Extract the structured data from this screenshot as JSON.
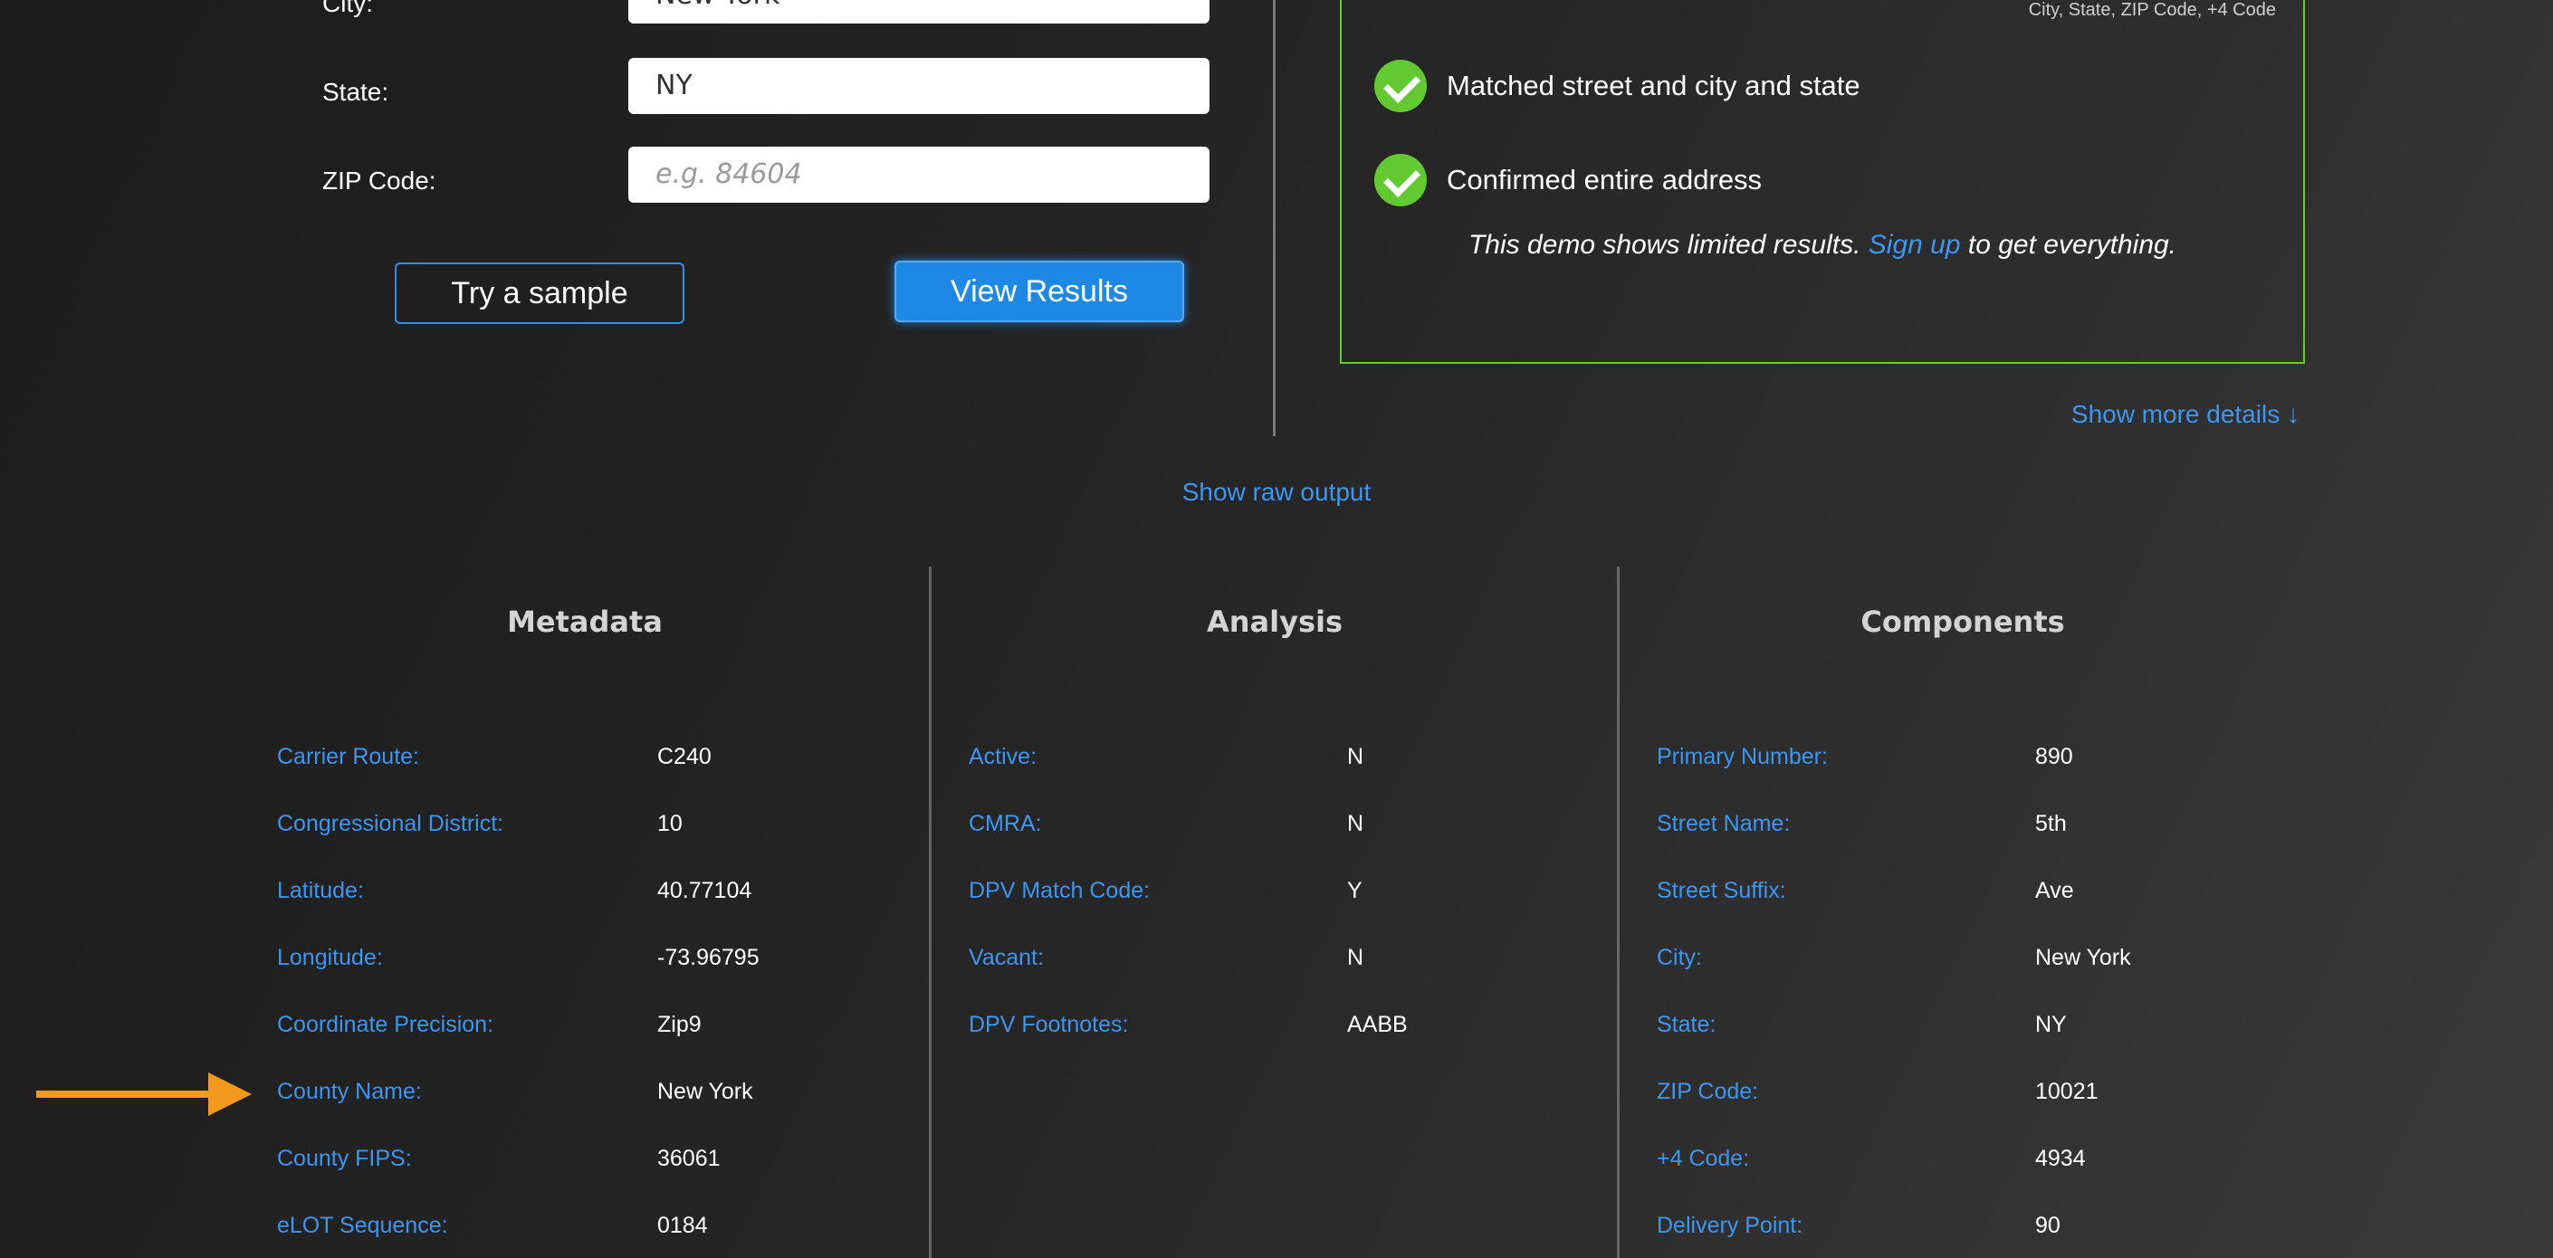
{
  "form": {
    "city_label": "City:",
    "city_value": "New York",
    "state_label": "State:",
    "state_value": "NY",
    "zip_label": "ZIP Code:",
    "zip_placeholder": "e.g. 84604",
    "sample_button": "Try a sample",
    "results_button": "View Results"
  },
  "result": {
    "subtitle": "City, State, ZIP Code, +4 Code",
    "checks": [
      {
        "icon": "check-circle-icon",
        "text": "Matched street and city and state"
      },
      {
        "icon": "check-circle-icon",
        "text": "Confirmed entire address"
      }
    ],
    "note_before": "This demo shows limited results.",
    "note_link": "Sign up",
    "note_after": "to get everything.",
    "border_color": "#5fcf2a"
  },
  "links": {
    "show_more": "Show more details ↓",
    "show_raw": "Show raw output"
  },
  "metadata": {
    "title": "Metadata",
    "rows": [
      {
        "label": "Carrier Route:",
        "value": "C240"
      },
      {
        "label": "Congressional District:",
        "value": "10"
      },
      {
        "label": "Latitude:",
        "value": "40.77104"
      },
      {
        "label": "Longitude:",
        "value": "-73.96795"
      },
      {
        "label": "Coordinate Precision:",
        "value": "Zip9"
      },
      {
        "label": "County Name:",
        "value": "New York"
      },
      {
        "label": "County FIPS:",
        "value": "36061"
      },
      {
        "label": "eLOT Sequence:",
        "value": "0184"
      }
    ]
  },
  "analysis": {
    "title": "Analysis",
    "rows": [
      {
        "label": "Active:",
        "value": "N"
      },
      {
        "label": "CMRA:",
        "value": "N"
      },
      {
        "label": "DPV Match Code:",
        "value": "Y"
      },
      {
        "label": "Vacant:",
        "value": "N"
      },
      {
        "label": "DPV Footnotes:",
        "value": "AABB"
      }
    ]
  },
  "components": {
    "title": "Components",
    "rows": [
      {
        "label": "Primary Number:",
        "value": "890"
      },
      {
        "label": "Street Name:",
        "value": "5th"
      },
      {
        "label": "Street Suffix:",
        "value": "Ave"
      },
      {
        "label": "City:",
        "value": "New York"
      },
      {
        "label": "State:",
        "value": "NY"
      },
      {
        "label": "ZIP Code:",
        "value": "10021"
      },
      {
        "label": "+4 Code:",
        "value": "4934"
      },
      {
        "label": "Delivery Point:",
        "value": "90"
      }
    ]
  },
  "colors": {
    "accent": "#1e88e5",
    "link": "#3d96ef",
    "success": "#63c931",
    "arrow": "#f39a1e"
  },
  "annotation": {
    "icon": "arrow-right-icon"
  }
}
